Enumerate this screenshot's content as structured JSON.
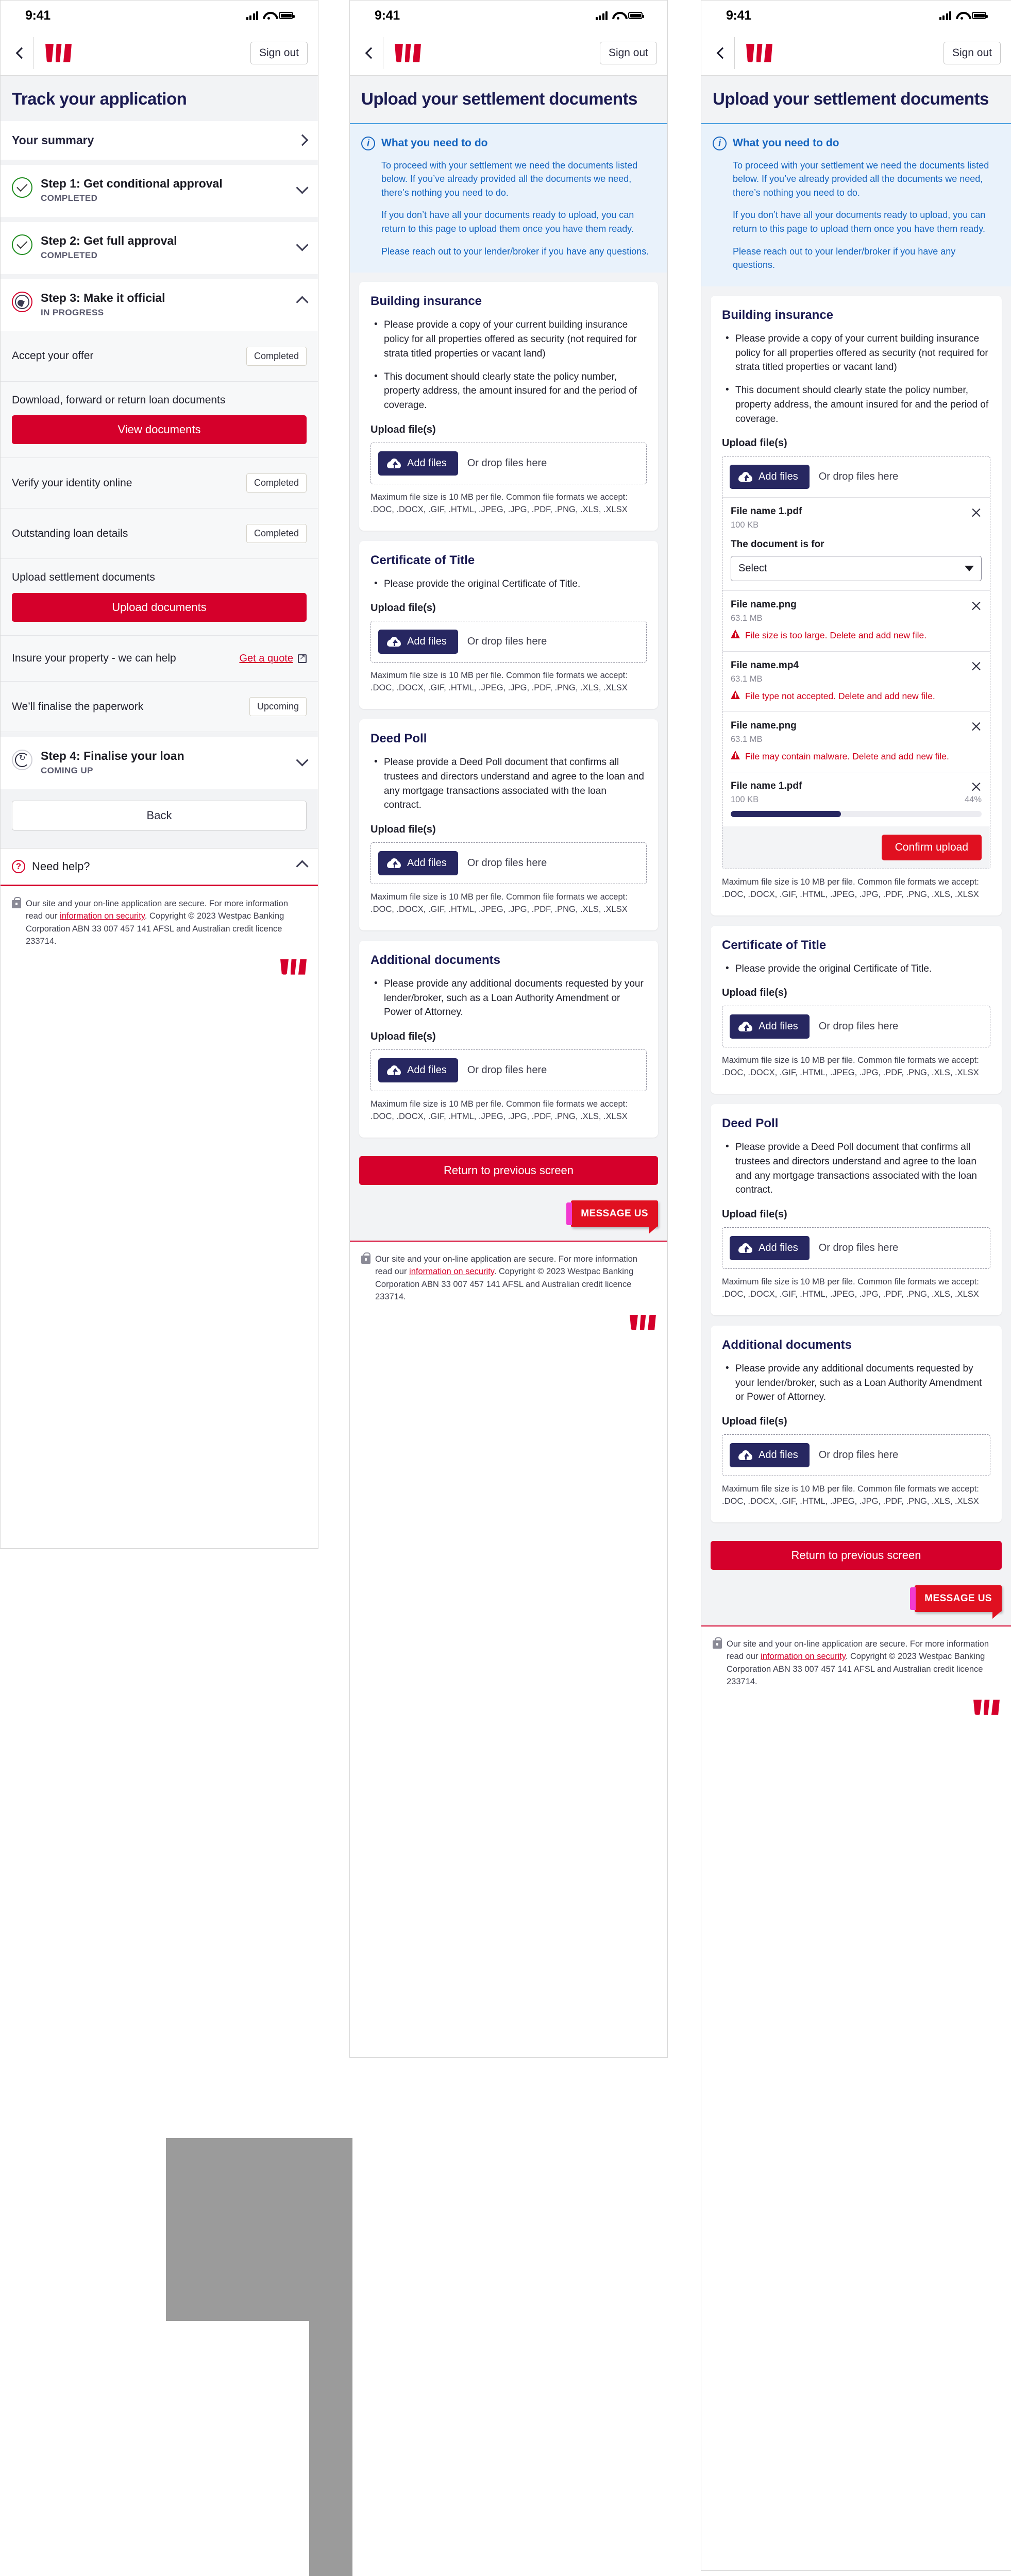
{
  "status_bar": {
    "time": "9:41"
  },
  "nav": {
    "sign_out": "Sign out",
    "back_icon": "chevron-left-icon",
    "logo": "westpac-logo"
  },
  "panel1": {
    "title": "Track your application",
    "summary": {
      "label": "Your summary"
    },
    "steps": [
      {
        "title": "Step 1: Get conditional approval",
        "status": "COMPLETED",
        "state": "done"
      },
      {
        "title": "Step 2: Get full approval",
        "status": "COMPLETED",
        "state": "done"
      },
      {
        "title": "Step 3: Make it official",
        "status": "IN PROGRESS",
        "state": "in-progress"
      }
    ],
    "subtasks": [
      {
        "label": "Accept your offer",
        "pill": "Completed"
      },
      {
        "label": "Download, forward or return loan documents",
        "button": "View documents"
      },
      {
        "label": "Verify your identity online",
        "pill": "Completed"
      },
      {
        "label": "Outstanding loan details",
        "pill": "Completed"
      },
      {
        "label": "Upload settlement documents",
        "button": "Upload documents"
      },
      {
        "label": "Insure your property - we can help",
        "link": "Get a quote"
      },
      {
        "label": "We’ll finalise the paperwork",
        "pill": "Upcoming"
      }
    ],
    "step4": {
      "title": "Step 4: Finalise your loan",
      "status": "COMING UP",
      "state": "upcoming"
    },
    "back_button": "Back",
    "need_help": "Need help?"
  },
  "upload_page": {
    "title": "Upload your settlement documents",
    "callout": {
      "heading": "What you need to do",
      "p1": "To proceed with your settlement we need the documents listed below. If you’ve already provided all the documents we need, there’s nothing you need to do.",
      "p2": "If you don’t have all your documents ready to upload, you can return to this page to upload them once you have them ready.",
      "p3": "Please reach out to your lender/broker if you have any questions."
    },
    "upload_label": "Upload file(s)",
    "add_files": "Add files",
    "drop_hint": "Or drop files here",
    "formats": "Maximum file size is 10 MB per file. Common file formats we accept: .DOC, .DOCX, .GIF, .HTML, .JPEG, .JPG, .PDF, .PNG, .XLS, .XLSX",
    "return_button": "Return to previous screen",
    "message_us": "MESSAGE US",
    "sections": [
      {
        "title": "Building insurance",
        "bullets": [
          "Please provide a copy of your current building insurance policy for all properties offered as security (not required for strata titled properties or vacant land)",
          "This document should clearly state the policy number, property address, the amount insured for and the period of coverage."
        ]
      },
      {
        "title": "Certificate of Title",
        "bullets": [
          "Please provide the original Certificate of Title."
        ]
      },
      {
        "title": "Deed Poll",
        "bullets": [
          "Please provide a Deed Poll document that confirms all trustees and directors understand and agree to the loan and any mortgage transactions associated with the loan contract."
        ]
      },
      {
        "title": "Additional documents",
        "bullets": [
          "Please provide any additional documents requested by your lender/broker, such as a Loan Authority Amendment or Power of Attorney."
        ]
      }
    ]
  },
  "file_list": {
    "document_is_for_label": "The document is for",
    "select_placeholder": "Select",
    "confirm_upload": "Confirm upload",
    "files": [
      {
        "name": "File name 1.pdf",
        "size": "100 KB",
        "state": "needs-category"
      },
      {
        "name": "File name.png",
        "size": "63.1 MB",
        "state": "error",
        "error": "File size is too large. Delete and add new file."
      },
      {
        "name": "File name.mp4",
        "size": "63.1 MB",
        "state": "error",
        "error": "File type not accepted. Delete and add new file."
      },
      {
        "name": "File name.png",
        "size": "63.1 MB",
        "state": "error",
        "error": "File may contain malware. Delete and add new file."
      },
      {
        "name": "File name 1.pdf",
        "size": "100 KB",
        "state": "uploading",
        "progress": "44%",
        "progress_value": 44
      }
    ]
  },
  "footer": {
    "secure_text": "Our site and your on-line application are secure. For more information read our ",
    "link": "information on security",
    "copyright": ". Copyright © 2023 Westpac Banking Corporation ABN 33 007 457 141 AFSL and Australian credit licence 233714."
  },
  "colors": {
    "brand_red": "#d5002b",
    "navy": "#1b1b52",
    "info_blue": "#1565c0",
    "error_red": "#d0021b",
    "success_green": "#1e8c1e"
  }
}
